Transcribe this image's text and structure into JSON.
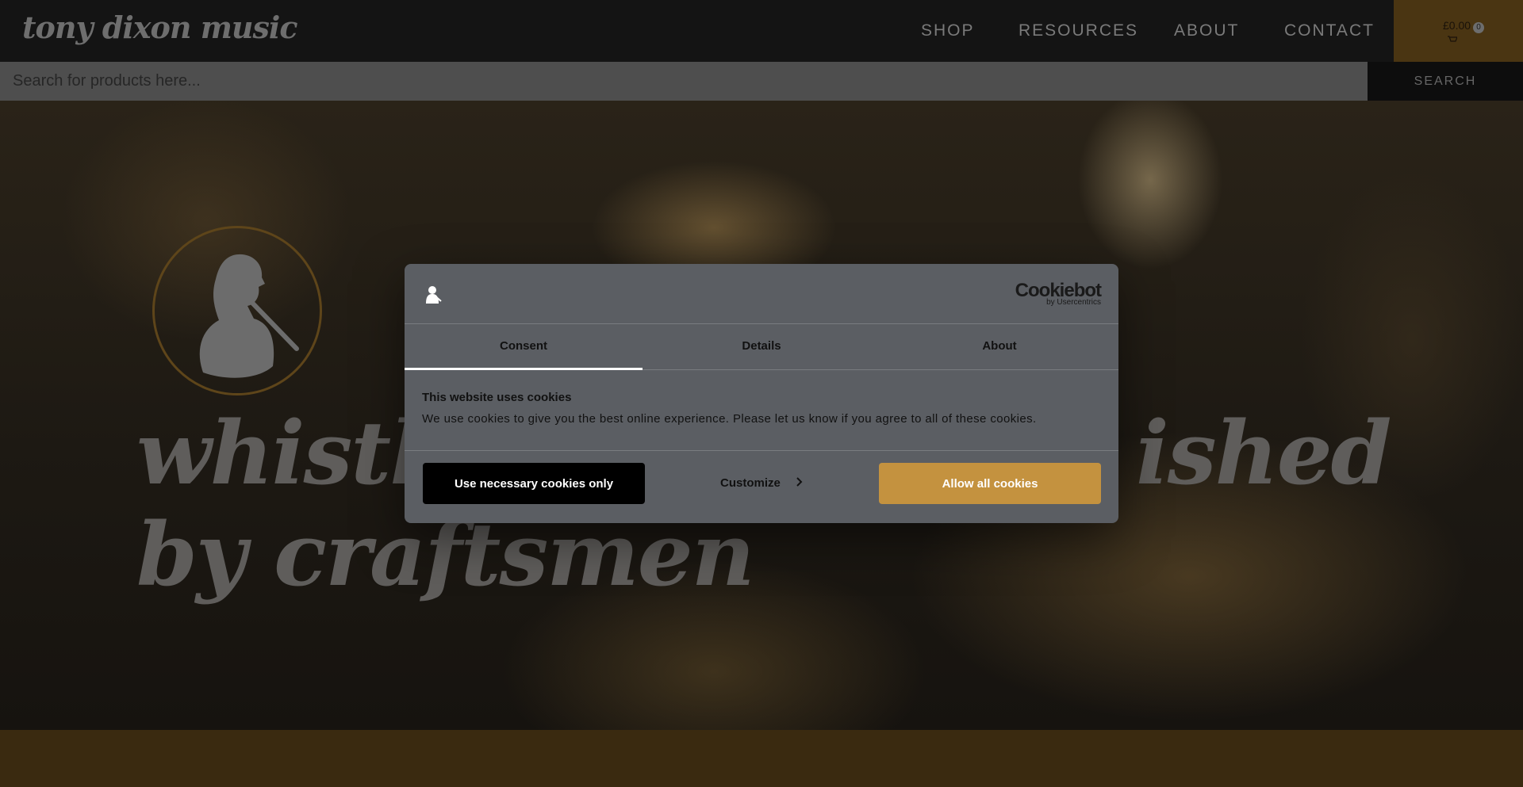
{
  "header": {
    "logo": "tony dixon music",
    "nav": [
      {
        "label": "SHOP"
      },
      {
        "label": "RESOURCES"
      },
      {
        "label": "ABOUT"
      },
      {
        "label": "CONTACT"
      }
    ],
    "cart": {
      "total": "£0.00",
      "count": "0"
    }
  },
  "search": {
    "placeholder": "Search for products here...",
    "button_label": "SEARCH"
  },
  "hero": {
    "line1": "whistles",
    "line1_tail": "ished",
    "line2": "by craftsmen"
  },
  "cookie_dialog": {
    "brand": "Cookiebot",
    "brand_sub": "by Usercentrics",
    "tabs": [
      {
        "label": "Consent",
        "active": true
      },
      {
        "label": "Details"
      },
      {
        "label": "About"
      }
    ],
    "title": "This website uses cookies",
    "text": "We use cookies to give you the best online experience. Please let us know if you agree to all of these cookies.",
    "buttons": {
      "necessary": "Use necessary cookies only",
      "customize": "Customize",
      "allow": "Allow all cookies"
    }
  },
  "colors": {
    "accent": "#c4923f",
    "dialog_bg": "#5b5e63"
  }
}
